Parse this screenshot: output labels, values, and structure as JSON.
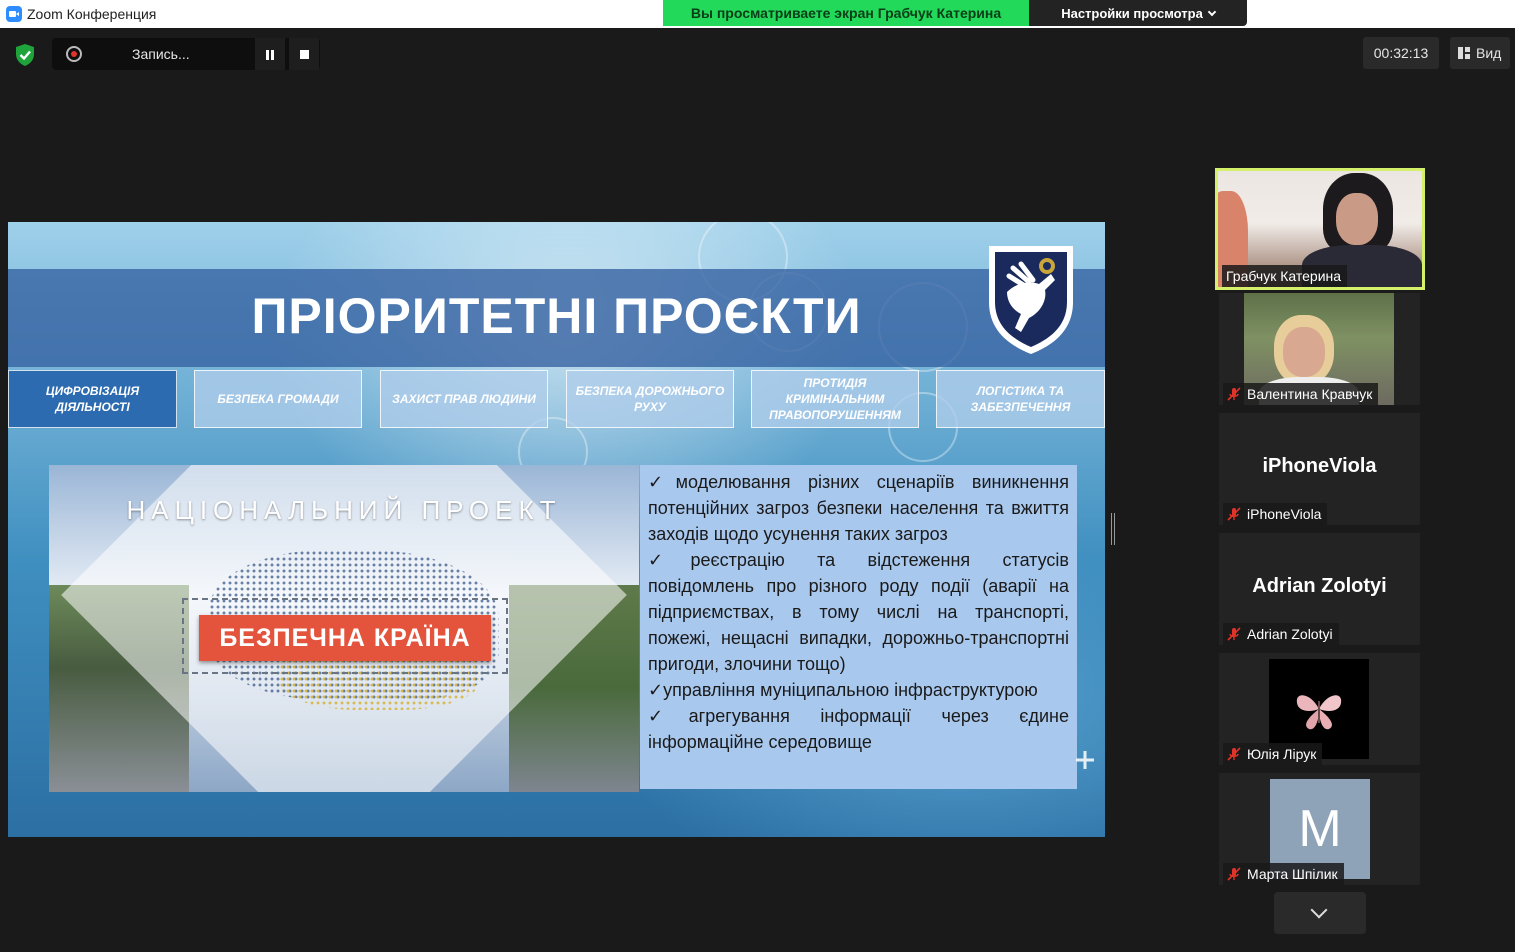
{
  "window": {
    "title": "Zoom Конференция",
    "share_banner": "Вы просматриваете экран Грабчук Катерина",
    "view_settings_label": "Настройки просмотра"
  },
  "toolbar": {
    "recording_label": "Запись...",
    "timer": "00:32:13",
    "view_label": "Вид"
  },
  "slide": {
    "title": "ПРІОРИТЕТНІ ПРОЄКТИ",
    "tabs": [
      {
        "label": "ЦИФРОВІЗАЦІЯ ДІЯЛЬНОСТІ",
        "active": true
      },
      {
        "label": "БЕЗПЕКА ГРОМАДИ",
        "active": false
      },
      {
        "label": "ЗАХИСТ ПРАВ ЛЮДИНИ",
        "active": false
      },
      {
        "label": "БЕЗПЕКА ДОРОЖНЬОГО РУХУ",
        "active": false
      },
      {
        "label": "ПРОТИДІЯ КРИМІНАЛЬНИМ ПРАВОПОРУШЕННЯМ",
        "active": false
      },
      {
        "label": "ЛОГІСТИКА ТА ЗАБЕЗПЕЧЕННЯ",
        "active": false
      }
    ],
    "picture": {
      "heading": "НАЦІОНАЛЬНИЙ ПРОЕКТ",
      "badge": "БЕЗПЕЧНА КРАЇНА"
    },
    "bullets": [
      "✓моделювання різних сценаріїв виникнення потенційних загроз безпеки населення та вжиття заходів щодо усунення таких загроз",
      "✓реєстрацію та відстеження статусів повідомлень про різного роду події (аварії на підприємствах, в тому числі на транспорті, пожежі, нещасні випадки, дорожньо-транспортні пригоди, злочини тощо)",
      "✓управління муніципальною інфраструктурою",
      "✓агрегування інформації через єдине інформаційне середовище"
    ]
  },
  "participants": [
    {
      "name": "Грабчук Катерина",
      "type": "video",
      "speaking": true,
      "muted": false
    },
    {
      "name": "Валентина Кравчук",
      "type": "video",
      "speaking": false,
      "muted": true
    },
    {
      "name": "iPhoneViola",
      "type": "name",
      "display": "iPhoneViola",
      "muted": true
    },
    {
      "name": "Adrian Zolotyi",
      "type": "name",
      "display": "Adrian Zolotyi",
      "muted": true
    },
    {
      "name": "Юлія Лірук",
      "type": "image",
      "muted": true
    },
    {
      "name": "Марта Шпілик",
      "type": "avatar",
      "letter": "M",
      "muted": true
    }
  ],
  "colors": {
    "share_banner": "#23d959",
    "speaker_border": "#d5f06b",
    "muted_icon": "#e0332a",
    "active_tab": "#2c6bb0"
  }
}
